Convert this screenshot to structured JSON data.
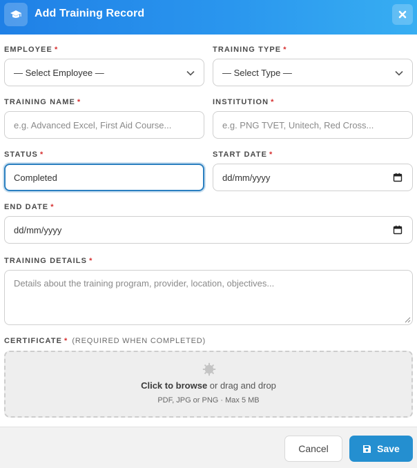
{
  "header": {
    "title": "Add Training Record",
    "icon": "graduation-cap-icon",
    "close_icon": "close-icon"
  },
  "colors": {
    "header_start": "#1f80e6",
    "header_end": "#37aef2",
    "required": "#d62f2f",
    "focus_border": "#2a7fc0",
    "primary_button": "#248fd0"
  },
  "form": {
    "employee": {
      "label": "Employee",
      "required": "*",
      "value": "— Select Employee —"
    },
    "training_type": {
      "label": "Training Type",
      "required": "*",
      "value": "— Select Type —"
    },
    "training_name": {
      "label": "Training Name",
      "required": "*",
      "placeholder": "e.g. Advanced Excel, First Aid Course..."
    },
    "institution": {
      "label": "Institution",
      "required": "*",
      "placeholder": "e.g. PNG TVET, Unitech, Red Cross..."
    },
    "status": {
      "label": "Status",
      "required": "*",
      "value": "Completed"
    },
    "start_date": {
      "label": "Start Date",
      "required": "*",
      "placeholder": "dd/mm/yyyy"
    },
    "end_date": {
      "label": "End Date",
      "required": "*",
      "placeholder": "dd/mm/yyyy"
    },
    "training_details": {
      "label": "Training Details",
      "required": "*",
      "placeholder": "Details about the training program, provider, location, objectives..."
    },
    "certificate": {
      "label": "Certificate",
      "required": "*",
      "note": "(Required when completed)",
      "browse_text": "Click to browse",
      "drag_text": " or drag and drop",
      "formats": "PDF, JPG or PNG · Max 5 MB"
    }
  },
  "footer": {
    "cancel_label": "Cancel",
    "save_label": "Save",
    "save_icon": "floppy-disk-icon"
  }
}
